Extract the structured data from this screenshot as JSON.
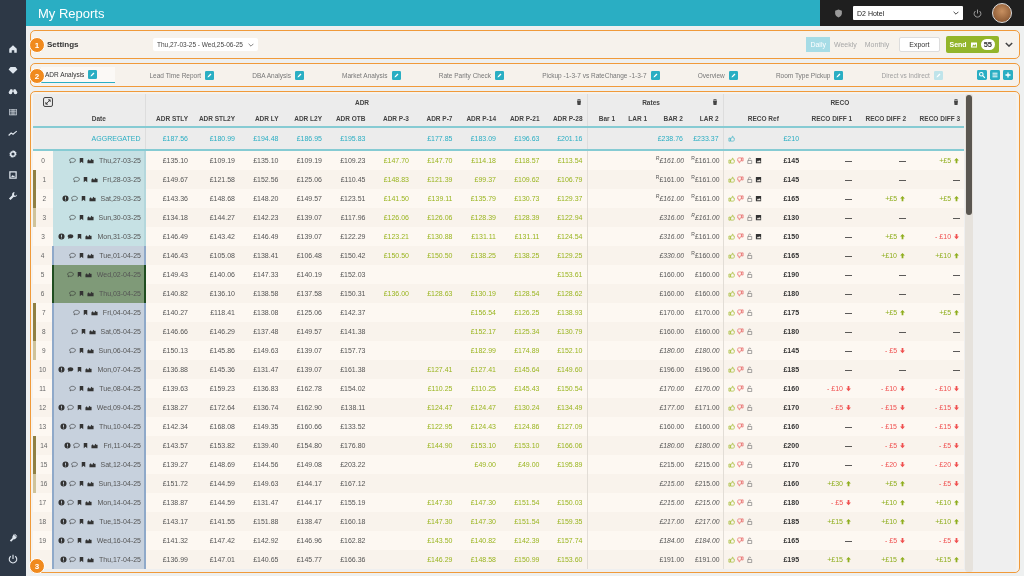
{
  "header": {
    "title": "My Reports",
    "hotel": "D2 Hotel"
  },
  "settings": {
    "callout": "1",
    "label": "Settings",
    "date_range": "Thu,27-03-25 - Wed,25-06-25",
    "periods": [
      {
        "label": "Daily",
        "selected": true
      },
      {
        "label": "Weekly",
        "selected": false
      },
      {
        "label": "Monthly",
        "selected": false
      }
    ],
    "export": "Export",
    "send": "Send",
    "send_count": "55"
  },
  "tabs_callout": "2",
  "tabs": [
    {
      "label": "ADR Analysis",
      "selected": true,
      "disabled": false
    },
    {
      "label": "Lead Time Report",
      "selected": false,
      "disabled": false
    },
    {
      "label": "DBA Analysis",
      "selected": false,
      "disabled": false
    },
    {
      "label": "Market Analysis",
      "selected": false,
      "disabled": false
    },
    {
      "label": "Rate Parity Check",
      "selected": false,
      "disabled": false
    },
    {
      "label": "Pickup -1-3-7 vs RateChange -1-3-7",
      "selected": false,
      "disabled": false
    },
    {
      "label": "Overview",
      "selected": false,
      "disabled": false
    },
    {
      "label": "Room Type Pickup",
      "selected": false,
      "disabled": false
    },
    {
      "label": "Direct vs Indirect",
      "selected": false,
      "disabled": true
    }
  ],
  "table": {
    "callout": "3",
    "date_label": "Date",
    "groups": [
      {
        "title": "ADR",
        "columns": [
          {
            "label": "ADR STLY",
            "kind": "history"
          },
          {
            "label": "ADR STL2Y",
            "kind": "history"
          },
          {
            "label": "ADR LY",
            "kind": "history"
          },
          {
            "label": "ADR L2Y",
            "kind": "history"
          },
          {
            "label": "ADR OTB",
            "kind": "history"
          },
          {
            "label": "ADR P-3",
            "kind": "pickup"
          },
          {
            "label": "ADR P-7",
            "kind": "pickup"
          },
          {
            "label": "ADR P-14",
            "kind": "pickup"
          },
          {
            "label": "ADR P-21",
            "kind": "pickup"
          },
          {
            "label": "ADR P-28",
            "kind": "pickup"
          }
        ]
      },
      {
        "title": "Rates",
        "columns": [
          {
            "label": "Bar 1",
            "kind": "rate"
          },
          {
            "label": "LAR 1",
            "kind": "rate"
          },
          {
            "label": "BAR 2",
            "kind": "rate"
          },
          {
            "label": "LAR 2",
            "kind": "rate"
          }
        ]
      },
      {
        "title": "RECO",
        "columns": [
          {
            "label": "RECO Ref",
            "kind": "reco"
          },
          {
            "label": "RECO DIFF 1",
            "kind": "diff"
          },
          {
            "label": "RECO DIFF 2",
            "kind": "diff"
          },
          {
            "label": "RECO DIFF 3",
            "kind": "diff"
          }
        ]
      }
    ],
    "aggregated": {
      "label": "AGGREGATED",
      "adr": {
        "stly": "£187.56",
        "stl2y": "£180.99",
        "ly": "£194.48",
        "l2y": "£186.95",
        "otb": "£195.83",
        "p7": "£177.85",
        "p14": "£183.09",
        "p21": "£196.63",
        "p28": "£201.16"
      },
      "bar2": "£238.76",
      "lar2": "£233.37",
      "reco": "£210"
    },
    "rows": [
      {
        "idx": "0",
        "date": "Thu,27-03-25",
        "kind": "past",
        "alert": false,
        "comment_filled": false,
        "adr": {
          "stly": "£135.10",
          "stl2y": "£109.19",
          "ly": "£135.10",
          "l2y": "£109.19",
          "otb": "£109.23",
          "p3": "£147.70",
          "p7": "£147.70",
          "p14": "£114.18",
          "p21": "£118.57",
          "p28": "£113.54"
        },
        "bar2": {
          "text": "$^{R}$£161.00",
          "italic": true
        },
        "lar2": {
          "text": "$^{R}$£161.00",
          "italic": false
        },
        "image": true,
        "reco": "£145",
        "diffs": [
          {
            "text": "—",
            "kind": "flat"
          },
          {
            "text": "—",
            "kind": "flat"
          },
          {
            "text": "+£5",
            "kind": "up"
          }
        ]
      },
      {
        "idx": "1",
        "date": "Fri,28-03-25",
        "kind": "past",
        "color": "#8f8043",
        "alert": false,
        "comment_filled": false,
        "adr": {
          "stly": "£149.67",
          "stl2y": "£121.58",
          "ly": "£152.56",
          "l2y": "£125.06",
          "otb": "£110.45",
          "p3": "£148.83",
          "p7": "£121.39",
          "p14": "£99.37",
          "p21": "£109.62",
          "p28": "£106.79"
        },
        "bar2": {
          "text": "$^{R}$£161.00",
          "italic": false
        },
        "lar2": {
          "text": "$^{R}$£161.00",
          "italic": false
        },
        "image": true,
        "reco": "£145",
        "diffs": [
          {
            "text": "—",
            "kind": "flat"
          },
          {
            "text": "—",
            "kind": "flat"
          },
          {
            "text": "—",
            "kind": "flat"
          }
        ]
      },
      {
        "idx": "2",
        "date": "Sat,29-03-25",
        "kind": "past",
        "color": "#8f8043",
        "alert": true,
        "comment_filled": false,
        "adr": {
          "stly": "£143.36",
          "stl2y": "£148.68",
          "ly": "£148.20",
          "l2y": "£149.57",
          "otb": "£123.51",
          "p3": "£141.50",
          "p7": "£139.11",
          "p14": "£135.79",
          "p21": "£130.73",
          "p28": "£129.37"
        },
        "bar2": {
          "text": "$^{R}$£161.00",
          "italic": true
        },
        "lar2": {
          "text": "$^{R}$£161.00",
          "italic": false
        },
        "image": true,
        "reco": "£165",
        "diffs": [
          {
            "text": "—",
            "kind": "flat"
          },
          {
            "text": "+£5",
            "kind": "up"
          },
          {
            "text": "+£5",
            "kind": "up"
          }
        ]
      },
      {
        "idx": "3",
        "date": "Sun,30-03-25",
        "kind": "past",
        "color": "#cfc39a",
        "alert": false,
        "comment_filled": false,
        "adr": {
          "stly": "£134.18",
          "stl2y": "£144.27",
          "ly": "£142.23",
          "l2y": "£139.07",
          "otb": "£117.96",
          "p3": "£126.06",
          "p7": "£126.06",
          "p14": "£128.39",
          "p21": "£128.39",
          "p28": "£122.94"
        },
        "bar2": {
          "text": "£316.00",
          "italic": true
        },
        "lar2": {
          "text": "$^{R}$£161.00",
          "italic": true
        },
        "image": true,
        "reco": "£130",
        "diffs": [
          {
            "text": "—",
            "kind": "flat"
          },
          {
            "text": "—",
            "kind": "flat"
          },
          {
            "text": "—",
            "kind": "flat"
          }
        ]
      },
      {
        "idx": "3",
        "date": "Mon,31-03-25",
        "kind": "past",
        "alert": true,
        "comment_filled": true,
        "adr": {
          "stly": "£146.49",
          "stl2y": "£143.42",
          "ly": "£146.49",
          "l2y": "£139.07",
          "otb": "£122.29",
          "p3": "£123.21",
          "p7": "£130.88",
          "p14": "£131.11",
          "p21": "£131.11",
          "p28": "£124.54"
        },
        "bar2": {
          "text": "£316.00",
          "italic": true
        },
        "lar2": {
          "text": "$^{R}$£161.00",
          "italic": false
        },
        "image": true,
        "reco": "£150",
        "diffs": [
          {
            "text": "—",
            "kind": "flat"
          },
          {
            "text": "+£5",
            "kind": "up"
          },
          {
            "text": "- £10",
            "kind": "down"
          }
        ]
      },
      {
        "idx": "4",
        "date": "Tue,01-04-25",
        "kind": "upcoming",
        "alert": false,
        "comment_filled": false,
        "adr": {
          "stly": "£146.43",
          "stl2y": "£105.08",
          "ly": "£138.41",
          "l2y": "£106.48",
          "otb": "£150.42",
          "p3": "£150.50",
          "p7": "£150.50",
          "p14": "£138.25",
          "p21": "£138.25",
          "p28": "£129.25"
        },
        "bar2": {
          "text": "£330.00",
          "italic": true
        },
        "lar2": {
          "text": "$^{R}$£160.00",
          "italic": false
        },
        "image": false,
        "reco": "£165",
        "diffs": [
          {
            "text": "—",
            "kind": "flat"
          },
          {
            "text": "+£10",
            "kind": "up"
          },
          {
            "text": "+£10",
            "kind": "up"
          }
        ]
      },
      {
        "idx": "5",
        "date": "Wed,02-04-25",
        "kind": "current",
        "alert": false,
        "comment_filled": false,
        "adr": {
          "stly": "£149.43",
          "stl2y": "£140.06",
          "ly": "£147.33",
          "l2y": "£140.19",
          "otb": "£152.03",
          "p28": "£153.61"
        },
        "bar2": {
          "text": "£160.00",
          "italic": false
        },
        "lar2": {
          "text": "£160.00",
          "italic": false
        },
        "image": false,
        "reco": "£190",
        "diffs": [
          {
            "text": "—",
            "kind": "flat"
          },
          {
            "text": "—",
            "kind": "flat"
          },
          {
            "text": "—",
            "kind": "flat"
          }
        ]
      },
      {
        "idx": "6",
        "date": "Thu,03-04-25",
        "kind": "current",
        "alert": false,
        "comment_filled": false,
        "adr": {
          "stly": "£140.82",
          "stl2y": "£136.10",
          "ly": "£138.58",
          "l2y": "£137.58",
          "otb": "£150.31",
          "p3": "£136.00",
          "p7": "£128.63",
          "p14": "£130.19",
          "p21": "£128.54",
          "p28": "£128.62"
        },
        "bar2": {
          "text": "£160.00",
          "italic": false
        },
        "lar2": {
          "text": "£160.00",
          "italic": false
        },
        "image": false,
        "reco": "£180",
        "diffs": [
          {
            "text": "—",
            "kind": "flat"
          },
          {
            "text": "—",
            "kind": "flat"
          },
          {
            "text": "—",
            "kind": "flat"
          }
        ]
      },
      {
        "idx": "7",
        "date": "Fri,04-04-25",
        "kind": "upcoming",
        "color": "#8f8043",
        "alert": false,
        "comment_filled": false,
        "adr": {
          "stly": "£140.27",
          "stl2y": "£118.41",
          "ly": "£138.08",
          "l2y": "£125.06",
          "otb": "£142.37",
          "p14": "£156.54",
          "p21": "£126.25",
          "p28": "£138.93"
        },
        "bar2": {
          "text": "£170.00",
          "italic": false
        },
        "lar2": {
          "text": "£170.00",
          "italic": false
        },
        "image": false,
        "reco": "£175",
        "diffs": [
          {
            "text": "—",
            "kind": "flat"
          },
          {
            "text": "+£5",
            "kind": "up"
          },
          {
            "text": "+£5",
            "kind": "up"
          }
        ]
      },
      {
        "idx": "8",
        "date": "Sat,05-04-25",
        "kind": "upcoming",
        "color": "#8f8043",
        "alert": false,
        "comment_filled": false,
        "adr": {
          "stly": "£146.66",
          "stl2y": "£146.29",
          "ly": "£137.48",
          "l2y": "£149.57",
          "otb": "£141.38",
          "p14": "£152.17",
          "p21": "£125.34",
          "p28": "£130.79"
        },
        "bar2": {
          "text": "£160.00",
          "italic": false
        },
        "lar2": {
          "text": "£160.00",
          "italic": false
        },
        "image": false,
        "reco": "£180",
        "diffs": [
          {
            "text": "—",
            "kind": "flat"
          },
          {
            "text": "—",
            "kind": "flat"
          },
          {
            "text": "—",
            "kind": "flat"
          }
        ]
      },
      {
        "idx": "9",
        "date": "Sun,06-04-25",
        "kind": "upcoming",
        "color": "#cfc39a",
        "alert": false,
        "comment_filled": false,
        "adr": {
          "stly": "£150.13",
          "stl2y": "£145.86",
          "ly": "£149.63",
          "l2y": "£139.07",
          "otb": "£157.73",
          "p14": "£182.99",
          "p21": "£174.89",
          "p28": "£152.10"
        },
        "bar2": {
          "text": "£180.00",
          "italic": true
        },
        "lar2": {
          "text": "£180.00",
          "italic": true
        },
        "image": false,
        "reco": "£145",
        "diffs": [
          {
            "text": "—",
            "kind": "flat"
          },
          {
            "text": "- £5",
            "kind": "down"
          },
          {
            "text": "—",
            "kind": "flat"
          }
        ]
      },
      {
        "idx": "10",
        "date": "Mon,07-04-25",
        "kind": "upcoming",
        "alert": true,
        "comment_filled": true,
        "adr": {
          "stly": "£136.88",
          "stl2y": "£145.36",
          "ly": "£131.47",
          "l2y": "£139.07",
          "otb": "£161.38",
          "p7": "£127.41",
          "p14": "£127.41",
          "p21": "£145.64",
          "p28": "£149.60"
        },
        "bar2": {
          "text": "£196.00",
          "italic": false
        },
        "lar2": {
          "text": "£196.00",
          "italic": false
        },
        "image": false,
        "reco": "£185",
        "diffs": [
          {
            "text": "—",
            "kind": "flat"
          },
          {
            "text": "—",
            "kind": "flat"
          },
          {
            "text": "—",
            "kind": "flat"
          }
        ]
      },
      {
        "idx": "11",
        "date": "Tue,08-04-25",
        "kind": "upcoming",
        "alert": false,
        "comment_filled": false,
        "adr": {
          "stly": "£139.63",
          "stl2y": "£159.23",
          "ly": "£136.83",
          "l2y": "£162.78",
          "otb": "£154.02",
          "p7": "£110.25",
          "p14": "£110.25",
          "p21": "£145.43",
          "p28": "£150.54"
        },
        "bar2": {
          "text": "£170.00",
          "italic": true
        },
        "lar2": {
          "text": "£170.00",
          "italic": true
        },
        "image": false,
        "reco": "£160",
        "diffs": [
          {
            "text": "- £10",
            "kind": "down"
          },
          {
            "text": "- £10",
            "kind": "down"
          },
          {
            "text": "- £10",
            "kind": "down"
          }
        ]
      },
      {
        "idx": "12",
        "date": "Wed,09-04-25",
        "kind": "upcoming",
        "alert": true,
        "comment_filled": false,
        "adr": {
          "stly": "£138.27",
          "stl2y": "£172.64",
          "ly": "£136.74",
          "l2y": "£162.90",
          "otb": "£138.11",
          "p7": "£124.47",
          "p14": "£124.47",
          "p21": "£130.24",
          "p28": "£134.49"
        },
        "bar2": {
          "text": "£177.00",
          "italic": true
        },
        "lar2": {
          "text": "£171.00",
          "italic": false
        },
        "image": false,
        "reco": "£170",
        "diffs": [
          {
            "text": "- £5",
            "kind": "down"
          },
          {
            "text": "- £15",
            "kind": "down"
          },
          {
            "text": "- £15",
            "kind": "down"
          }
        ]
      },
      {
        "idx": "13",
        "date": "Thu,10-04-25",
        "kind": "upcoming",
        "alert": true,
        "comment_filled": false,
        "adr": {
          "stly": "£142.34",
          "stl2y": "£168.08",
          "ly": "£149.35",
          "l2y": "£160.66",
          "otb": "£133.52",
          "p7": "£122.95",
          "p14": "£124.43",
          "p21": "£124.86",
          "p28": "£127.09"
        },
        "bar2": {
          "text": "£160.00",
          "italic": false
        },
        "lar2": {
          "text": "£160.00",
          "italic": false
        },
        "image": false,
        "reco": "£160",
        "diffs": [
          {
            "text": "—",
            "kind": "flat"
          },
          {
            "text": "- £15",
            "kind": "down"
          },
          {
            "text": "- £15",
            "kind": "down"
          }
        ]
      },
      {
        "idx": "14",
        "date": "Fri,11-04-25",
        "kind": "upcoming",
        "color": "#8f8043",
        "alert": true,
        "comment_filled": false,
        "adr": {
          "stly": "£143.57",
          "stl2y": "£153.82",
          "ly": "£139.40",
          "l2y": "£154.80",
          "otb": "£176.80",
          "p7": "£144.90",
          "p14": "£153.10",
          "p21": "£153.10",
          "p28": "£166.06"
        },
        "bar2": {
          "text": "£180.00",
          "italic": true
        },
        "lar2": {
          "text": "£180.00",
          "italic": true
        },
        "image": false,
        "reco": "£200",
        "diffs": [
          {
            "text": "—",
            "kind": "flat"
          },
          {
            "text": "- £5",
            "kind": "down"
          },
          {
            "text": "- £5",
            "kind": "down"
          }
        ]
      },
      {
        "idx": "15",
        "date": "Sat,12-04-25",
        "kind": "upcoming",
        "color": "#8f8043",
        "alert": true,
        "comment_filled": false,
        "adr": {
          "stly": "£139.27",
          "stl2y": "£148.69",
          "ly": "£144.56",
          "l2y": "£149.08",
          "otb": "£203.22",
          "p14": "£49.00",
          "p21": "£49.00",
          "p28": "£195.89"
        },
        "bar2": {
          "text": "£215.00",
          "italic": false
        },
        "lar2": {
          "text": "£215.00",
          "italic": false
        },
        "image": false,
        "reco": "£170",
        "diffs": [
          {
            "text": "—",
            "kind": "flat"
          },
          {
            "text": "- £20",
            "kind": "down"
          },
          {
            "text": "- £20",
            "kind": "down"
          }
        ]
      },
      {
        "idx": "16",
        "date": "Sun,13-04-25",
        "kind": "upcoming",
        "color": "#cfc39a",
        "alert": true,
        "comment_filled": false,
        "adr": {
          "stly": "£151.72",
          "stl2y": "£144.59",
          "ly": "£149.63",
          "l2y": "£144.17",
          "otb": "£167.12"
        },
        "bar2": {
          "text": "£215.00",
          "italic": true
        },
        "lar2": {
          "text": "£215.00",
          "italic": false
        },
        "image": false,
        "reco": "£160",
        "diffs": [
          {
            "text": "+£30",
            "kind": "up"
          },
          {
            "text": "+£5",
            "kind": "up"
          },
          {
            "text": "- £5",
            "kind": "down"
          }
        ]
      },
      {
        "idx": "17",
        "date": "Mon,14-04-25",
        "kind": "upcoming",
        "alert": true,
        "comment_filled": false,
        "adr": {
          "stly": "£138.87",
          "stl2y": "£144.59",
          "ly": "£131.47",
          "l2y": "£144.17",
          "otb": "£155.19",
          "p7": "£147.30",
          "p14": "£147.30",
          "p21": "£151.54",
          "p28": "£150.03"
        },
        "bar2": {
          "text": "£215.00",
          "italic": true
        },
        "lar2": {
          "text": "£215.00",
          "italic": true
        },
        "image": false,
        "reco": "£180",
        "diffs": [
          {
            "text": "- £5",
            "kind": "down"
          },
          {
            "text": "+£10",
            "kind": "up"
          },
          {
            "text": "+£10",
            "kind": "up"
          }
        ]
      },
      {
        "idx": "18",
        "date": "Tue,15-04-25",
        "kind": "upcoming",
        "alert": true,
        "comment_filled": false,
        "adr": {
          "stly": "£143.17",
          "stl2y": "£141.55",
          "ly": "£151.88",
          "l2y": "£138.47",
          "otb": "£160.18",
          "p7": "£147.30",
          "p14": "£147.30",
          "p21": "£151.54",
          "p28": "£159.35"
        },
        "bar2": {
          "text": "£217.00",
          "italic": true
        },
        "lar2": {
          "text": "£217.00",
          "italic": true
        },
        "image": false,
        "reco": "£185",
        "diffs": [
          {
            "text": "+£15",
            "kind": "up"
          },
          {
            "text": "+£10",
            "kind": "up"
          },
          {
            "text": "+£10",
            "kind": "up"
          }
        ]
      },
      {
        "idx": "19",
        "date": "Wed,16-04-25",
        "kind": "upcoming",
        "alert": true,
        "comment_filled": false,
        "adr": {
          "stly": "£141.32",
          "stl2y": "£147.42",
          "ly": "£142.92",
          "l2y": "£146.96",
          "otb": "£162.82",
          "p7": "£143.50",
          "p14": "£140.82",
          "p21": "£142.39",
          "p28": "£157.74"
        },
        "bar2": {
          "text": "£184.00",
          "italic": true
        },
        "lar2": {
          "text": "£184.00",
          "italic": true
        },
        "image": false,
        "reco": "£165",
        "diffs": [
          {
            "text": "—",
            "kind": "flat"
          },
          {
            "text": "- £5",
            "kind": "down"
          },
          {
            "text": "- £5",
            "kind": "down"
          }
        ]
      },
      {
        "date": "Thu,17-04-25",
        "kind": "upcoming",
        "alert": true,
        "comment_filled": false,
        "adr": {
          "stly": "£136.99",
          "stl2y": "£147.01",
          "ly": "£140.65",
          "l2y": "£145.77",
          "otb": "£166.36",
          "p7": "£146.29",
          "p14": "£148.58",
          "p21": "£150.99",
          "p28": "£153.60"
        },
        "bar2": {
          "text": "£191.00",
          "italic": false
        },
        "lar2": {
          "text": "£191.00",
          "italic": false
        },
        "image": false,
        "reco": "£195",
        "diffs": [
          {
            "text": "+£15",
            "kind": "up"
          },
          {
            "text": "+£15",
            "kind": "up"
          },
          {
            "text": "+£15",
            "kind": "up"
          }
        ]
      }
    ]
  }
}
